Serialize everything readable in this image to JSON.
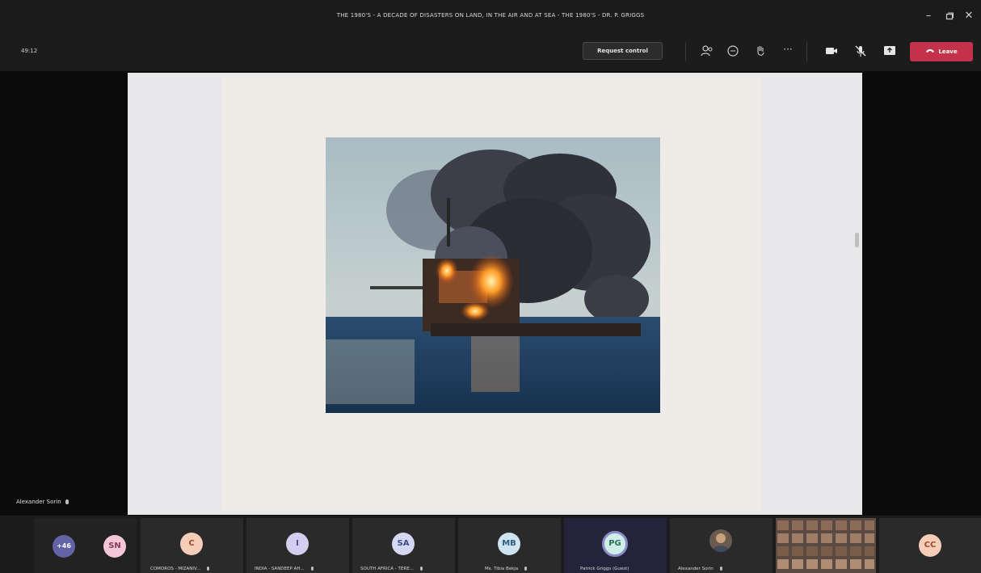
{
  "window": {
    "title": "THE 1980'S - A DECADE OF DISASTERS ON LAND, IN THE AIR AND AT SEA - THE 1980'S - DR. P. GRIGGS",
    "minimize_icon": "minimize-icon",
    "maximize_icon": "maximize-icon",
    "close_icon": "close-icon"
  },
  "toolbar": {
    "timer": "49:12",
    "request_control_label": "Request control",
    "leave_label": "Leave",
    "icons": [
      "participants-icon",
      "chat-icon",
      "raise-hand-icon",
      "more-options-icon",
      "camera-icon",
      "microphone-off-icon",
      "share-tray-icon",
      "phone-icon"
    ],
    "colors": {
      "leave": "#c4314b",
      "accent": "#6264a7"
    }
  },
  "stage": {
    "presenter_label": "Alexander Sorin",
    "slide_image": "offshore oil platform on fire at sea with dark smoke"
  },
  "participants": [
    {
      "initials": "+46",
      "label": "",
      "bg": "#6264a7",
      "fg": "#ffffff"
    },
    {
      "initials": "SN",
      "label": "",
      "bg": "#f4c7d8",
      "fg": "#8a3a5a"
    },
    {
      "initials": "C",
      "label": "COMOROS - MIZANIV...",
      "bg": "#f6cdb9",
      "fg": "#9a4a2a"
    },
    {
      "initials": "I",
      "label": "INDIA - SANDEEP AH...",
      "bg": "#d5cdf0",
      "fg": "#55458f"
    },
    {
      "initials": "SA",
      "label": "SOUTH AFRICA - TERE...",
      "bg": "#d5d8f2",
      "fg": "#3f4a8a"
    },
    {
      "initials": "MB",
      "label": "Ms. Tibia Bekja",
      "bg": "#cfe3f1",
      "fg": "#2e5f80"
    },
    {
      "initials": "PG",
      "label": "Patrick Griggs (Guest)",
      "bg": "#cfeee6",
      "fg": "#2c6e5e"
    },
    {
      "initials": "",
      "label": "Alexander Sorin",
      "bg": "#444444",
      "fg": "#ffffff"
    },
    {
      "initials": "",
      "label": "",
      "bg": "#555555",
      "fg": "#ffffff"
    },
    {
      "initials": "CC",
      "label": "",
      "bg": "#f6cdb9",
      "fg": "#9a4a2a"
    }
  ]
}
